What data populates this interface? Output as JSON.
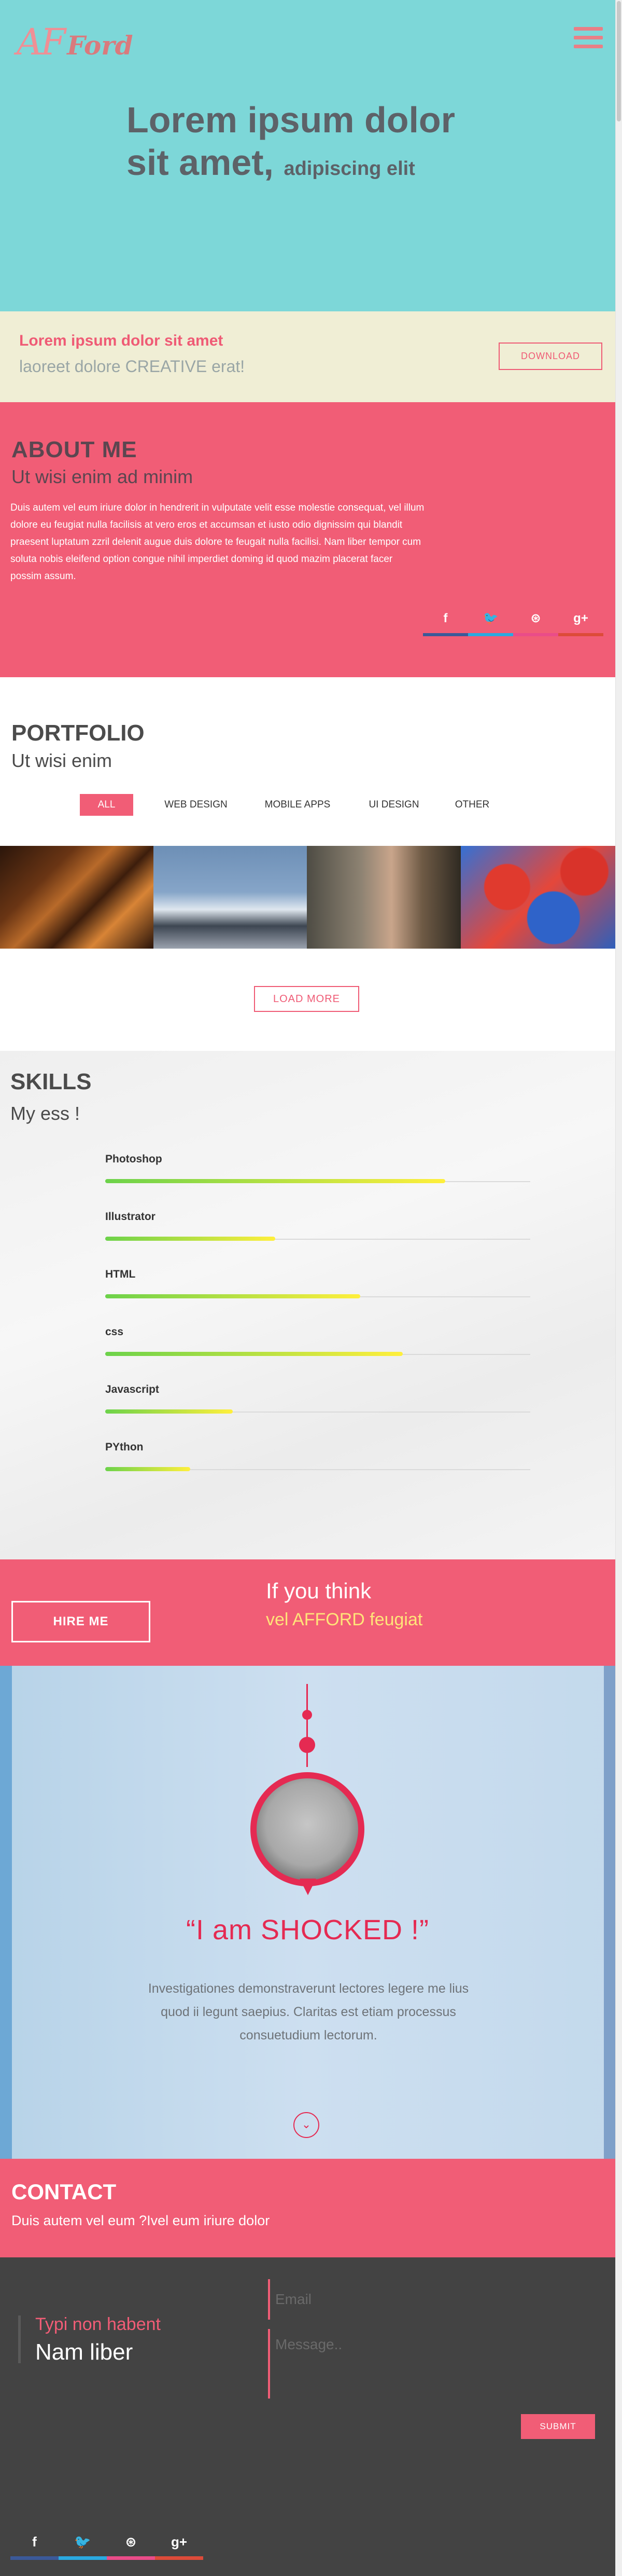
{
  "header": {
    "logo_initials": "AF",
    "logo_name": "Ford",
    "menu_icon": "hamburger-menu-icon"
  },
  "hero": {
    "title_line1": "Lorem ipsum dolor",
    "title_line2": "sit amet,",
    "title_small": "adipiscing elit"
  },
  "cta": {
    "title": "Lorem ipsum dolor sit amet",
    "subtitle": "laoreet dolore CREATIVE erat!",
    "button_label": "DOWNLOAD"
  },
  "about": {
    "heading": "ABOUT ME",
    "subheading": "Ut wisi enim ad minim",
    "text": "Duis autem vel eum iriure dolor in hendrerit in vulputate velit esse molestie consequat, vel illum dolore eu feugiat nulla facilisis at vero eros et accumsan et iusto odio dignissim qui blandit praesent luptatum zzril delenit augue duis dolore te feugait nulla facilisi. Nam liber tempor cum soluta nobis eleifend option congue nihil imperdiet doming id quod mazim placerat facer possim assum.",
    "social": [
      {
        "icon": "facebook-icon",
        "glyph": "f",
        "color": "#3b5998"
      },
      {
        "icon": "twitter-icon",
        "glyph": "🐦",
        "color": "#2aa9e0"
      },
      {
        "icon": "dribbble-icon",
        "glyph": "⊛",
        "color": "#ea4c89"
      },
      {
        "icon": "google-plus-icon",
        "glyph": "g+",
        "color": "#dd4b39"
      }
    ]
  },
  "portfolio": {
    "heading": "PORTFOLIO",
    "subheading": "Ut wisi enim",
    "filters": [
      "ALL",
      "WEB DESIGN",
      "MOBILE APPS",
      "UI DESIGN",
      "OTHER"
    ],
    "active_filter": "ALL",
    "load_more_label": "LOAD MORE"
  },
  "skills": {
    "heading": "SKILLS",
    "subheading": "My ess !",
    "items": [
      {
        "name": "Photoshop",
        "level": 0.8
      },
      {
        "name": "Illustrator",
        "level": 0.4
      },
      {
        "name": "HTML",
        "level": 0.6
      },
      {
        "name": "css",
        "level": 0.7
      },
      {
        "name": "Javascript",
        "level": 0.3
      },
      {
        "name": "PYthon",
        "level": 0.2
      }
    ]
  },
  "hire": {
    "button_label": "HIRE ME",
    "heading": "If you think",
    "subheading": "vel AFFORD feugiat"
  },
  "testimonial": {
    "quote_title": "“I am SHOCKED !”",
    "text": "Investigationes demonstraverunt lectores legere me lius quod ii legunt saepius. Claritas est etiam processus consuetudium lectorum.",
    "down_icon": "chevron-down-icon"
  },
  "contact": {
    "heading": "CONTACT",
    "subheading": "Duis autem vel eum ?Ivel eum iriure dolor"
  },
  "footer": {
    "line1": "Typi non habent",
    "line2": "Nam liber",
    "email_placeholder": "Email",
    "message_placeholder": "Message..",
    "submit_label": "SUBMIT",
    "social": [
      {
        "icon": "facebook-icon",
        "glyph": "f",
        "color": "#3b5998"
      },
      {
        "icon": "twitter-icon",
        "glyph": "🐦",
        "color": "#2aa9e0"
      },
      {
        "icon": "dribbble-icon",
        "glyph": "⊛",
        "color": "#ea4c89"
      },
      {
        "icon": "google-plus-icon",
        "glyph": "g+",
        "color": "#dd4b39"
      }
    ]
  }
}
